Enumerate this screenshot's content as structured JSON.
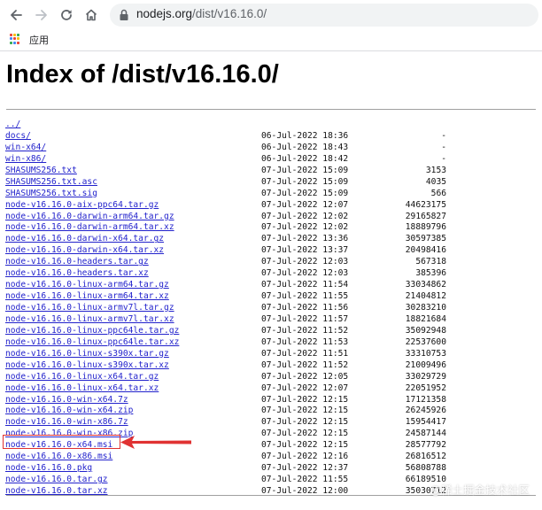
{
  "browser": {
    "url_host": "nodejs.org",
    "url_path": "/dist/v16.16.0/",
    "bookmarks_label": "应用",
    "apps_colors": [
      "#ea4335",
      "#fbbc05",
      "#34a853",
      "#4285f4",
      "#ea4335",
      "#fbbc05",
      "#34a853",
      "#4285f4",
      "#ea4335"
    ]
  },
  "page": {
    "title": "Index of /dist/v16.16.0/",
    "parent_link": "../",
    "entries": [
      {
        "name": "docs/",
        "date": "06-Jul-2022 18:36",
        "size": "-"
      },
      {
        "name": "win-x64/",
        "date": "06-Jul-2022 18:43",
        "size": "-"
      },
      {
        "name": "win-x86/",
        "date": "06-Jul-2022 18:42",
        "size": "-"
      },
      {
        "name": "SHASUMS256.txt",
        "date": "07-Jul-2022 15:09",
        "size": "3153"
      },
      {
        "name": "SHASUMS256.txt.asc",
        "date": "07-Jul-2022 15:09",
        "size": "4035"
      },
      {
        "name": "SHASUMS256.txt.sig",
        "date": "07-Jul-2022 15:09",
        "size": "566"
      },
      {
        "name": "node-v16.16.0-aix-ppc64.tar.gz",
        "date": "07-Jul-2022 12:07",
        "size": "44623175"
      },
      {
        "name": "node-v16.16.0-darwin-arm64.tar.gz",
        "date": "07-Jul-2022 12:02",
        "size": "29165827"
      },
      {
        "name": "node-v16.16.0-darwin-arm64.tar.xz",
        "date": "07-Jul-2022 12:02",
        "size": "18889796"
      },
      {
        "name": "node-v16.16.0-darwin-x64.tar.gz",
        "date": "07-Jul-2022 13:36",
        "size": "30597385"
      },
      {
        "name": "node-v16.16.0-darwin-x64.tar.xz",
        "date": "07-Jul-2022 13:37",
        "size": "20498416"
      },
      {
        "name": "node-v16.16.0-headers.tar.gz",
        "date": "07-Jul-2022 12:03",
        "size": "567318"
      },
      {
        "name": "node-v16.16.0-headers.tar.xz",
        "date": "07-Jul-2022 12:03",
        "size": "385396"
      },
      {
        "name": "node-v16.16.0-linux-arm64.tar.gz",
        "date": "07-Jul-2022 11:54",
        "size": "33034862"
      },
      {
        "name": "node-v16.16.0-linux-arm64.tar.xz",
        "date": "07-Jul-2022 11:55",
        "size": "21404812"
      },
      {
        "name": "node-v16.16.0-linux-armv7l.tar.gz",
        "date": "07-Jul-2022 11:56",
        "size": "30283210"
      },
      {
        "name": "node-v16.16.0-linux-armv7l.tar.xz",
        "date": "07-Jul-2022 11:57",
        "size": "18821684"
      },
      {
        "name": "node-v16.16.0-linux-ppc64le.tar.gz",
        "date": "07-Jul-2022 11:52",
        "size": "35092948"
      },
      {
        "name": "node-v16.16.0-linux-ppc64le.tar.xz",
        "date": "07-Jul-2022 11:53",
        "size": "22537600"
      },
      {
        "name": "node-v16.16.0-linux-s390x.tar.gz",
        "date": "07-Jul-2022 11:51",
        "size": "33310753"
      },
      {
        "name": "node-v16.16.0-linux-s390x.tar.xz",
        "date": "07-Jul-2022 11:52",
        "size": "21009496"
      },
      {
        "name": "node-v16.16.0-linux-x64.tar.gz",
        "date": "07-Jul-2022 12:05",
        "size": "33029729"
      },
      {
        "name": "node-v16.16.0-linux-x64.tar.xz",
        "date": "07-Jul-2022 12:07",
        "size": "22051952"
      },
      {
        "name": "node-v16.16.0-win-x64.7z",
        "date": "07-Jul-2022 12:15",
        "size": "17121358"
      },
      {
        "name": "node-v16.16.0-win-x64.zip",
        "date": "07-Jul-2022 12:15",
        "size": "26245926"
      },
      {
        "name": "node-v16.16.0-win-x86.7z",
        "date": "07-Jul-2022 12:15",
        "size": "15954417"
      },
      {
        "name": "node-v16.16.0-win-x86.zip",
        "date": "07-Jul-2022 12:15",
        "size": "24587144"
      },
      {
        "name": "node-v16.16.0-x64.msi",
        "date": "07-Jul-2022 12:15",
        "size": "28577792"
      },
      {
        "name": "node-v16.16.0-x86.msi",
        "date": "07-Jul-2022 12:16",
        "size": "26816512"
      },
      {
        "name": "node-v16.16.0.pkg",
        "date": "07-Jul-2022 12:37",
        "size": "56808788"
      },
      {
        "name": "node-v16.16.0.tar.gz",
        "date": "07-Jul-2022 11:55",
        "size": "66189510"
      },
      {
        "name": "node-v16.16.0.tar.xz",
        "date": "07-Jul-2022 12:00",
        "size": "35030712"
      }
    ]
  },
  "annotation": {
    "highlight_color": "#e03232"
  },
  "watermark": "@稀土掘金技术社区"
}
